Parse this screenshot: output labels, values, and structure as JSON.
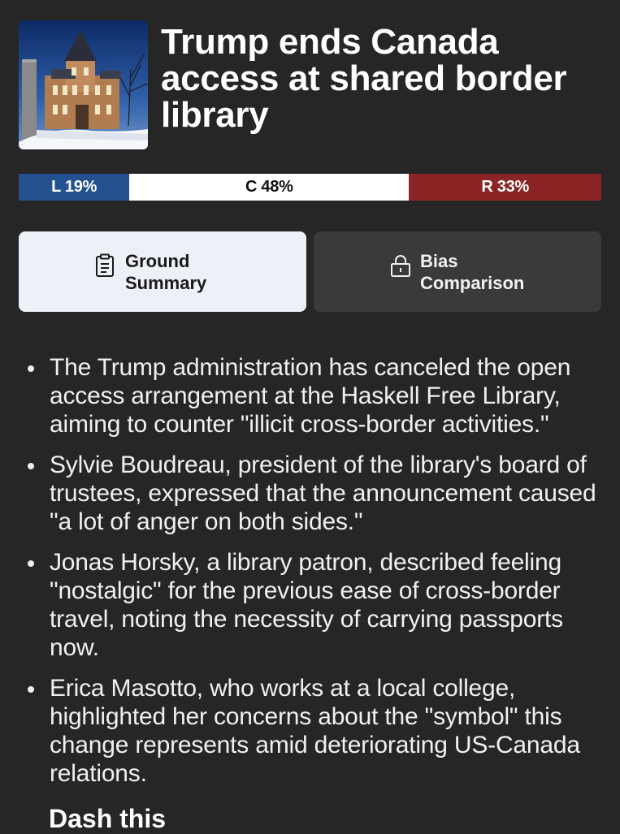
{
  "article": {
    "headline": "Trump ends Canada access at shared border library",
    "thumbnail_icon": "library-building-photo"
  },
  "bias": {
    "left_label": "L 19%",
    "center_label": "C 48%",
    "right_label": "R 33%",
    "left_percent": 19,
    "center_percent": 48,
    "right_percent": 33,
    "colors": {
      "left": "#23508f",
      "center": "#ffffff",
      "right": "#8b2424"
    }
  },
  "tabs": {
    "ground_summary": {
      "label": "Ground Summary",
      "icon": "clipboard-icon",
      "selected": true
    },
    "bias_comparison": {
      "label": "Bias Comparison",
      "icon": "lock-icon",
      "selected": false
    }
  },
  "summary": {
    "bullets": [
      "The Trump administration has canceled the open access arrangement at the Haskell Free Library, aiming to counter \"illicit cross-border activities.\"",
      "Sylvie Boudreau, president of the library's board of trustees, expressed that the announcement caused \"a lot of anger on both sides.\"",
      "Jonas Horsky, a library patron, described feeling \"nostalgic\" for the previous ease of cross-border travel, noting the necessity of carrying passports now.",
      "Erica Masotto, who works at a local college, highlighted her concerns about the \"symbol\" this change represents amid deteriorating US-Canada relations."
    ],
    "next_heading_partial": "Dash this"
  }
}
